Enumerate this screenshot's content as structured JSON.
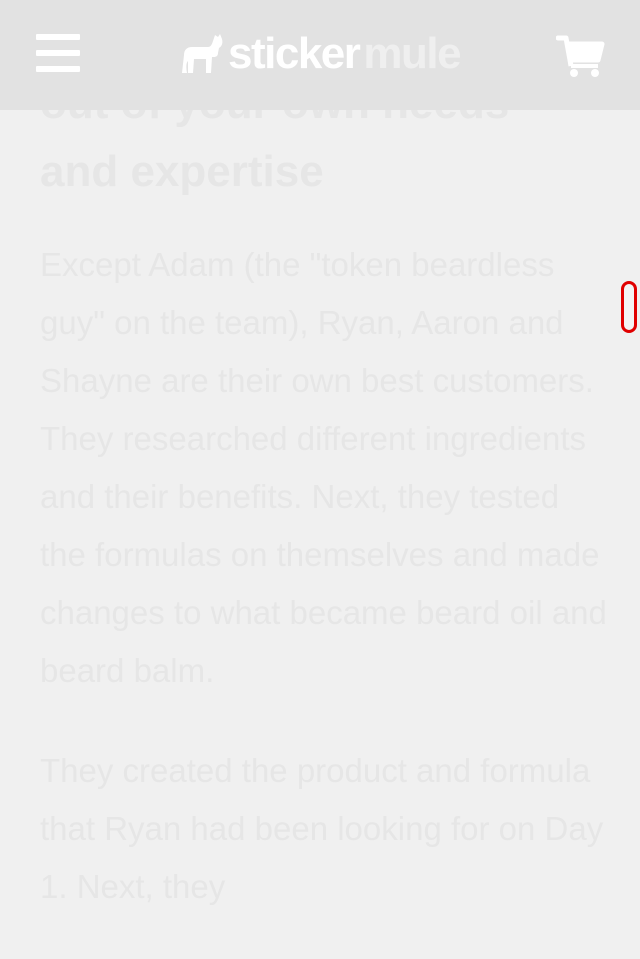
{
  "header": {
    "menu_icon": "hamburger-menu-icon",
    "logo": {
      "word_sticker": "sticker",
      "word_mule": "mule",
      "icon": "mule-logo-icon"
    },
    "cart_icon": "shopping-cart-icon"
  },
  "article": {
    "heading_line1": "out of your own needs",
    "heading_line2": "and expertise",
    "paragraph1": "Except Adam (the \"token beardless guy\" on the team), Ryan, Aaron and Shayne are their own best customers. They researched different ingredients and their benefits. Next, they tested the formulas on themselves and made changes to what became beard oil and beard balm.",
    "paragraph2": "They created the product and formula that Ryan had been looking for on Day 1. Next, they"
  },
  "colors": {
    "topbar": "#e2e2e2",
    "page_background": "#f0f0f0",
    "text": "#e6e6e6",
    "scroll_indicator_border": "#e00000"
  }
}
